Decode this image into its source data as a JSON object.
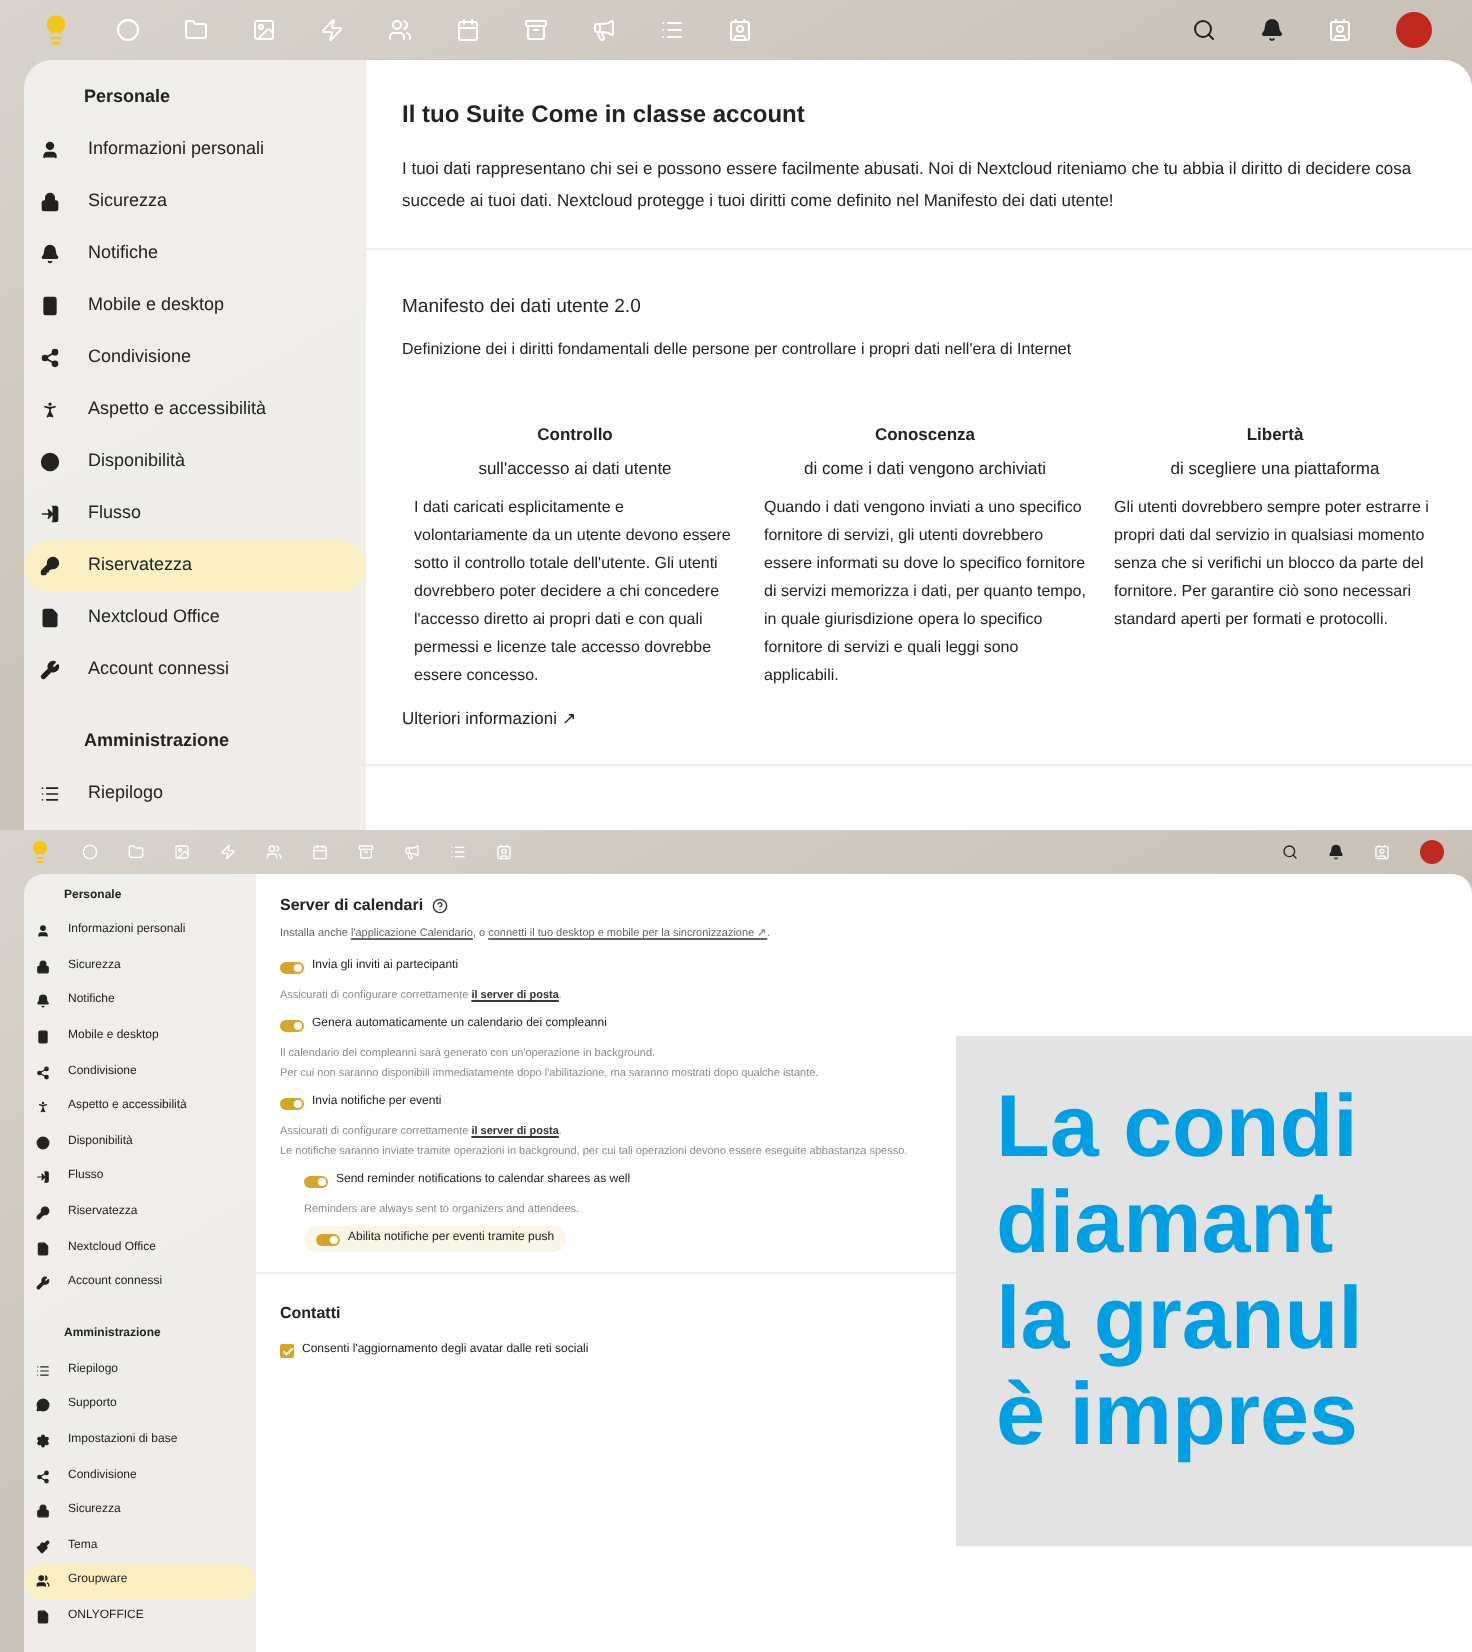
{
  "top_screenshot": {
    "sidebar": {
      "sections": [
        {
          "title": "Personale",
          "items": [
            {
              "label": "Informazioni personali",
              "selected": false
            },
            {
              "label": "Sicurezza",
              "selected": false
            },
            {
              "label": "Notifiche",
              "selected": false
            },
            {
              "label": "Mobile e desktop",
              "selected": false
            },
            {
              "label": "Condivisione",
              "selected": false
            },
            {
              "label": "Aspetto e accessibilità",
              "selected": false
            },
            {
              "label": "Disponibilità",
              "selected": false
            },
            {
              "label": "Flusso",
              "selected": false
            },
            {
              "label": "Riservatezza",
              "selected": true
            },
            {
              "label": "Nextcloud Office",
              "selected": false
            },
            {
              "label": "Account connessi",
              "selected": false
            }
          ]
        },
        {
          "title": "Amministrazione",
          "items": [
            {
              "label": "Riepilogo",
              "selected": false
            }
          ]
        }
      ]
    },
    "title": "Il tuo Suite Come in classe account",
    "intro": "I tuoi dati rappresentano chi sei e possono essere facilmente abusati. Noi di Nextcloud riteniamo che tu abbia il diritto di decidere cosa succede ai tuoi dati. Nextcloud protegge i tuoi diritti come definito nel Manifesto dei dati utente!",
    "manifesto_title": "Manifesto dei dati utente 2.0",
    "manifesto_subtitle": "Definizione dei i diritti fondamentali delle persone per controllare i propri dati nell'era di Internet",
    "columns": [
      {
        "heading": "Controllo",
        "subheading": "sull'accesso ai dati utente",
        "text": "I dati caricati esplicitamente e volontariamente da un utente devono essere sotto il controllo totale dell'utente. Gli utenti dovrebbero poter decidere a chi concedere l'accesso diretto ai propri dati e con quali permessi e licenze tale accesso dovrebbe essere concesso."
      },
      {
        "heading": "Conoscenza",
        "subheading": "di come i dati vengono archiviati",
        "text": "Quando i dati vengono inviati a uno specifico fornitore di servizi, gli utenti dovrebbero essere informati su dove lo specifico fornitore di servizi memorizza i dati, per quanto tempo, in quale giurisdizione opera lo specifico fornitore di servizi e quali leggi sono applicabili."
      },
      {
        "heading": "Libertà",
        "subheading": "di scegliere una piattaforma",
        "text": "Gli utenti dovrebbero sempre poter estrarre i propri dati dal servizio in qualsiasi momento senza che si verifichi un blocco da parte del fornitore. Per garantire ciò sono necessari standard aperti per formati e protocolli."
      }
    ],
    "more_link": "Ulteriori informazioni ↗"
  },
  "bottom_screenshot": {
    "sidebar": {
      "sections": [
        {
          "title": "Personale",
          "items": [
            {
              "label": "Informazioni personali",
              "selected": false
            },
            {
              "label": "Sicurezza",
              "selected": false
            },
            {
              "label": "Notifiche",
              "selected": false
            },
            {
              "label": "Mobile e desktop",
              "selected": false
            },
            {
              "label": "Condivisione",
              "selected": false
            },
            {
              "label": "Aspetto e accessibilità",
              "selected": false
            },
            {
              "label": "Disponibilità",
              "selected": false
            },
            {
              "label": "Flusso",
              "selected": false
            },
            {
              "label": "Riservatezza",
              "selected": false
            },
            {
              "label": "Nextcloud Office",
              "selected": false
            },
            {
              "label": "Account connessi",
              "selected": false
            }
          ]
        },
        {
          "title": "Amministrazione",
          "items": [
            {
              "label": "Riepilogo",
              "selected": false
            },
            {
              "label": "Supporto",
              "selected": false
            },
            {
              "label": "Impostazioni di base",
              "selected": false
            },
            {
              "label": "Condivisione",
              "selected": false
            },
            {
              "label": "Sicurezza",
              "selected": false
            },
            {
              "label": "Tema",
              "selected": false
            },
            {
              "label": "Groupware",
              "selected": true
            },
            {
              "label": "ONLYOFFICE",
              "selected": false
            }
          ]
        }
      ]
    },
    "calendar_title": "Server di calendari",
    "calendar_intro": {
      "before": "Installa anche ",
      "link1": "l'applicazione Calendario",
      "middle": ", o ",
      "link2": "connetti il tuo desktop e mobile per la sincronizzazione ↗",
      "after": "."
    },
    "settings": [
      {
        "kind": "toggle",
        "label": "Invia gli inviti ai partecipanti",
        "on": true,
        "highlighted": false
      },
      {
        "kind": "note",
        "lines": [
          {
            "text": "Assicurati di configurare correttamente ",
            "link": "il server di posta",
            "after": "."
          }
        ]
      },
      {
        "kind": "toggle",
        "label": "Genera automaticamente un calendario dei compleanni",
        "on": true,
        "highlighted": false
      },
      {
        "kind": "note",
        "lines": [
          {
            "text": "Il calendario dei compleanni sarà generato con un'operazione in background."
          },
          {
            "text": "Per cui non saranno disponibili immediatamente dopo l'abilitazione, ma saranno mostrati dopo qualche istante."
          }
        ]
      },
      {
        "kind": "toggle",
        "label": "Invia notifiche per eventi",
        "on": true,
        "highlighted": false
      },
      {
        "kind": "note",
        "lines": [
          {
            "text": "Assicurati di configurare correttamente ",
            "link": "il server di posta",
            "after": "."
          },
          {
            "text": "Le notifiche saranno inviate tramite operazioni in background, per cui tali operazioni devono essere eseguite abbastanza spesso."
          }
        ],
        "children": [
          {
            "kind": "toggle",
            "label": "Send reminder notifications to calendar sharees as well",
            "on": true,
            "highlighted": false
          },
          {
            "kind": "note",
            "lines": [
              {
                "text": "Reminders are always sent to organizers and attendees."
              }
            ]
          },
          {
            "kind": "toggle",
            "label": "Abilita notifiche per eventi tramite push",
            "on": true,
            "highlighted": true
          }
        ]
      }
    ],
    "contacts_title": "Contatti",
    "contacts_option": {
      "label": "Consenti l'aggiornamento degli avatar dalle reti sociali",
      "checked": true
    }
  },
  "pull_quote": {
    "lines": [
      "La condi",
      "diamant",
      "la granul",
      "è impres"
    ]
  }
}
